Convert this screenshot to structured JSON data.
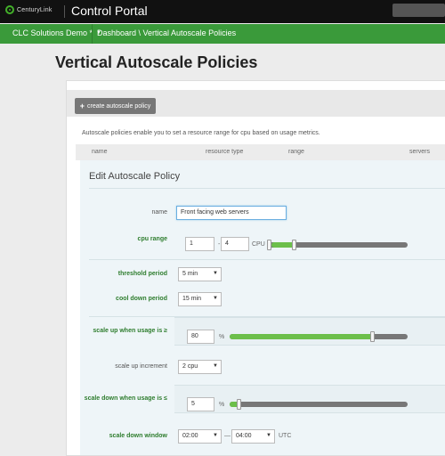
{
  "header": {
    "logo_text": "CenturyLink",
    "app_title": "Control Portal"
  },
  "nav": {
    "account": "CLC Solutions Demo *",
    "account_caret": "▼",
    "breadcrumb": "Dashboard \\ Vertical Autoscale Policies"
  },
  "page": {
    "title": "Vertical Autoscale Policies",
    "create_button": "create autoscale policy",
    "create_icon": "+",
    "description": "Autoscale policies enable you to set a resource range for cpu based on usage metrics."
  },
  "table": {
    "columns": [
      "name",
      "resource type",
      "range",
      "servers"
    ]
  },
  "form": {
    "title": "Edit Autoscale Policy",
    "name": {
      "label": "name",
      "value": "Front facing web servers"
    },
    "cpu_range": {
      "label": "cpu range",
      "min": "1",
      "separator": "-",
      "max": "4",
      "unit": "CPU",
      "slider_min": 1,
      "slider_max": 16
    },
    "threshold_period": {
      "label": "threshold period",
      "value": "5 min"
    },
    "cool_down_period": {
      "label": "cool down period",
      "value": "15 min"
    },
    "scale_up": {
      "label": "scale up when usage is ≥",
      "value": "80",
      "unit": "%",
      "level": 0.8
    },
    "scale_up_increment": {
      "label": "scale up increment",
      "value": "2 cpu"
    },
    "scale_down": {
      "label": "scale down when usage is ≤",
      "value": "5",
      "unit": "%",
      "level": 0.05
    },
    "scale_down_window": {
      "label": "scale down window",
      "start": "02:00",
      "separator": "—",
      "end": "04:00",
      "timezone": "UTC"
    }
  },
  "colors": {
    "accent_green": "#3a9a3a",
    "slider_fill": "#6cbf4a",
    "label_green": "#2e7d2e"
  },
  "icons": {
    "logo": "centurylink-logo-icon",
    "dropdown": "chevron-down-icon",
    "add": "plus-icon"
  }
}
